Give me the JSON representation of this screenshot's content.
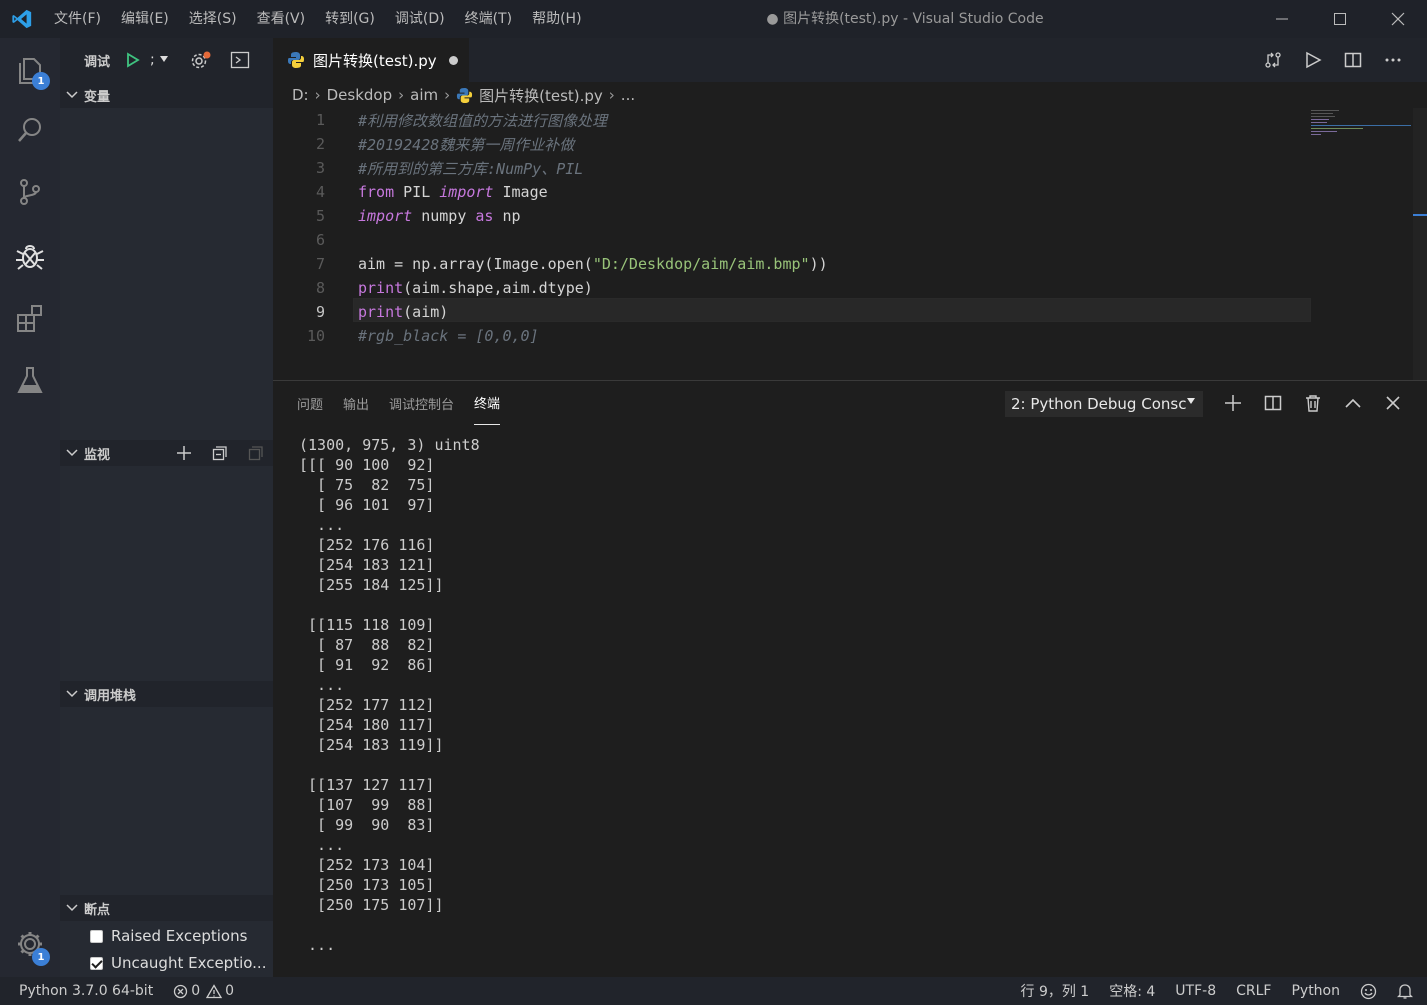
{
  "window": {
    "title": "● 图片转换(test).py - Visual Studio Code",
    "menu": [
      "文件(F)",
      "编辑(E)",
      "选择(S)",
      "查看(V)",
      "转到(G)",
      "调试(D)",
      "终端(T)",
      "帮助(H)"
    ]
  },
  "activity": {
    "explorer_badge": "1",
    "settings_badge": "1"
  },
  "sidebar": {
    "title": "调试",
    "sections": {
      "variables": "变量",
      "watch": "监视",
      "callstack": "调用堆栈",
      "breakpoints": "断点"
    },
    "breakpoints": [
      {
        "label": "Raised Exceptions",
        "checked": false
      },
      {
        "label": "Uncaught Exceptio...",
        "checked": true
      }
    ]
  },
  "tab": {
    "label": "图片转换(test).py",
    "dirty": true
  },
  "breadcrumb": [
    "D:",
    "Deskdop",
    "aim",
    "图片转换(test).py",
    "..."
  ],
  "code": {
    "active_line": 9,
    "lines": [
      {
        "n": "1",
        "text": "#利用修改数组值的方法进行图像处理"
      },
      {
        "n": "2",
        "text": "#20192428魏来第一周作业补做"
      },
      {
        "n": "3",
        "text": "#所用到的第三方库:NumPy、PIL"
      },
      {
        "n": "4",
        "text": "from PIL import Image"
      },
      {
        "n": "5",
        "text": "import numpy as np"
      },
      {
        "n": "6",
        "text": ""
      },
      {
        "n": "7",
        "text": "aim = np.array(Image.open(\"D:/Deskdop/aim/aim.bmp\"))"
      },
      {
        "n": "8",
        "text": "print(aim.shape,aim.dtype)"
      },
      {
        "n": "9",
        "text": "print(aim)"
      },
      {
        "n": "10",
        "text": "#rgb_black = [0,0,0]"
      }
    ]
  },
  "panel": {
    "tabs": [
      "问题",
      "输出",
      "调试控制台",
      "终端"
    ],
    "active_tab": "终端",
    "terminal_select": "2: Python Debug Consc",
    "terminal_output": "(1300, 975, 3) uint8\n[[[ 90 100  92]\n  [ 75  82  75]\n  [ 96 101  97]\n  ...\n  [252 176 116]\n  [254 183 121]\n  [255 184 125]]\n\n [[115 118 109]\n  [ 87  88  82]\n  [ 91  92  86]\n  ...\n  [252 177 112]\n  [254 180 117]\n  [254 183 119]]\n\n [[137 127 117]\n  [107  99  88]\n  [ 99  90  83]\n  ...\n  [252 173 104]\n  [250 173 105]\n  [250 175 107]]\n\n ..."
  },
  "status": {
    "interpreter": "Python 3.7.0 64-bit",
    "errors": "0",
    "warnings": "0",
    "position": "行 9，列 1",
    "spaces": "空格: 4",
    "encoding": "UTF-8",
    "eol": "CRLF",
    "language": "Python"
  }
}
